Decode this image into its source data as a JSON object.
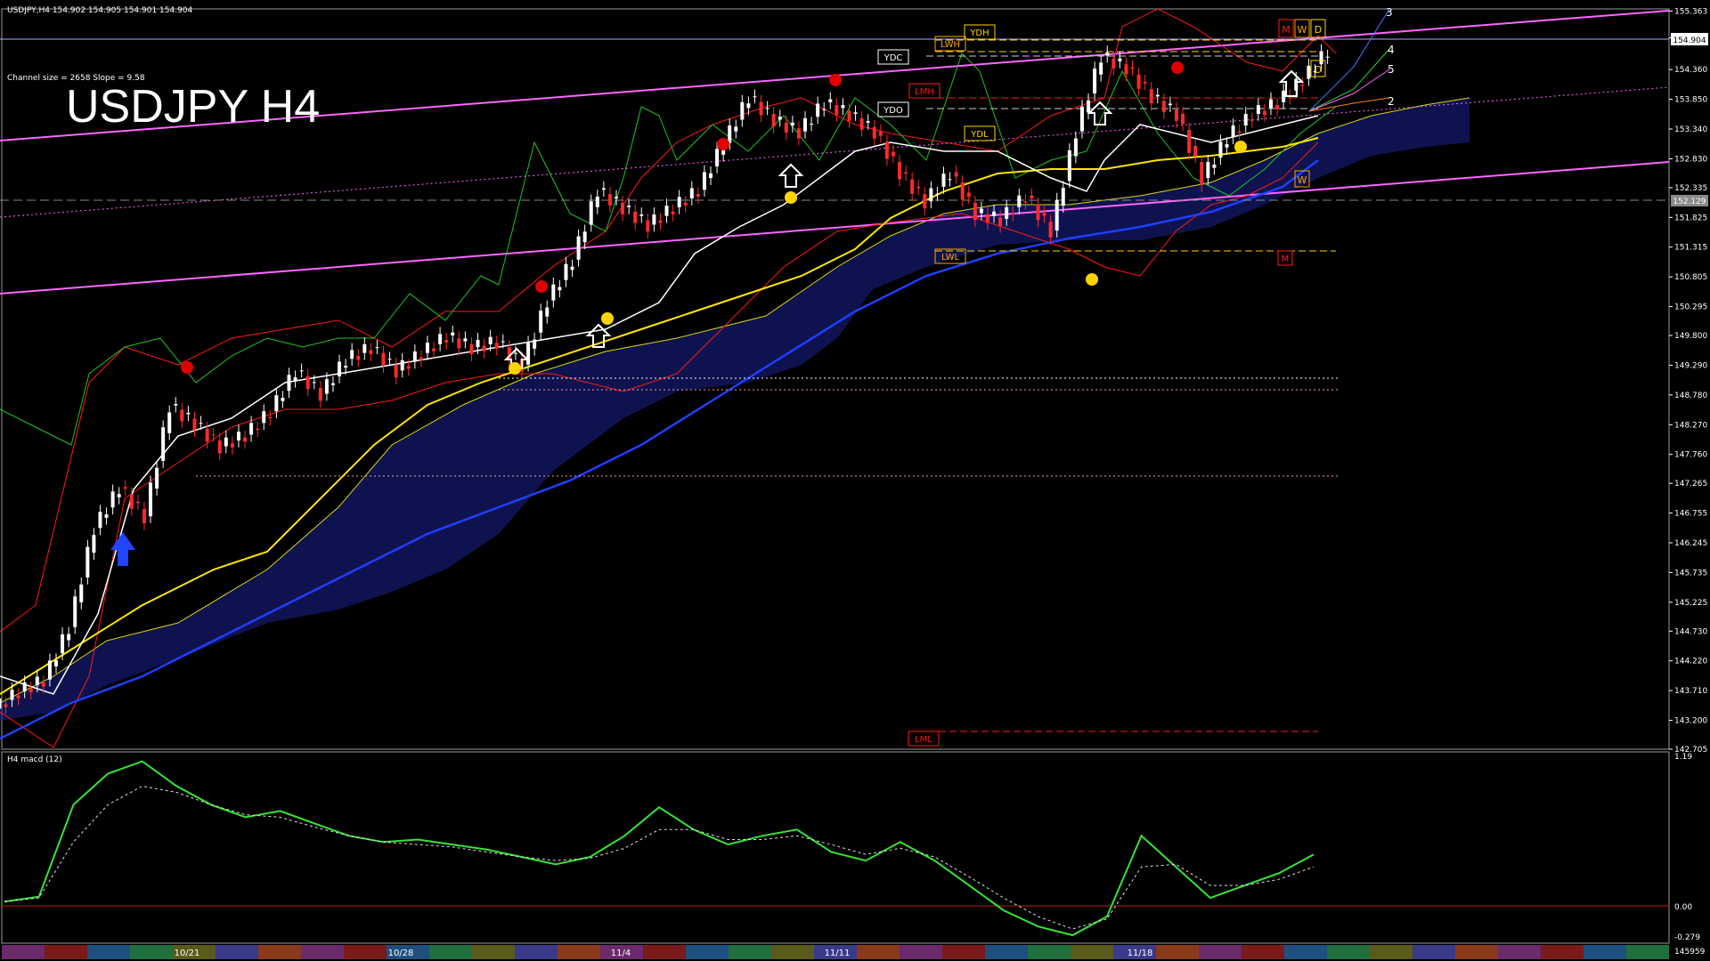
{
  "header": {
    "symbol_line": "USDJPY,H4  154.902  154.905  154.901  154.904",
    "channel_info": "Channel size = 2658 Slope = 9.58",
    "big_title": "USDJPY H4"
  },
  "colors": {
    "background": "#000000",
    "bull_candle": "#ffffff",
    "bear_candle": "#ff2a2a",
    "ema_white": "#ffffff",
    "ma_yellow": "#ffe600",
    "ma_blue": "#1f3fff",
    "channel": "#ff66ff",
    "bollinger": "#ff1a1a",
    "chikou": "#22c422",
    "cloud": "#2f3fd0",
    "macd_up": "#37e337",
    "macd_down": "#ff7fbf",
    "signal": "#dddddd",
    "grid_line": "#a0a0a0",
    "level_line": "#ffd400"
  },
  "chart_data": [
    {
      "type": "line",
      "title": "USDJPY H4",
      "current_price": 154.904,
      "reference_price": 152.129,
      "ylim": [
        142.705,
        155.4
      ],
      "y_ticks": [
        "155.363",
        "154.904",
        "154.360",
        "153.850",
        "153.340",
        "152.830",
        "152.335",
        "151.825",
        "151.315",
        "150.805",
        "150.295",
        "149.800",
        "149.290",
        "148.780",
        "148.270",
        "147.760",
        "147.265",
        "146.755",
        "146.245",
        "145.735",
        "145.225",
        "144.730",
        "144.220",
        "143.710",
        "143.200",
        "142.705"
      ],
      "x_ticks": [
        "10/21",
        "10/28",
        "11/4",
        "11/11",
        "11/18"
      ],
      "series": [
        {
          "name": "",
          "values": [
            143.7,
            143.9,
            144.8,
            146.5,
            147.2,
            146.7,
            148.6,
            148.3,
            147.9,
            148.1,
            148.5,
            149.2,
            148.8,
            149.4,
            149.6,
            149.2,
            149.5,
            149.8,
            149.6,
            149.7,
            149.3,
            150.4,
            151.1,
            152.3,
            152.0,
            151.7,
            152.0,
            152.3,
            153.1,
            153.9,
            153.5,
            153.3,
            153.8,
            153.6,
            153.3,
            152.6,
            152.1,
            152.6,
            151.9,
            151.8,
            152.2,
            151.6,
            153.3,
            154.6,
            154.4,
            153.9,
            153.6,
            152.5,
            153.2,
            153.6,
            153.8,
            154.2,
            154.7
          ]
        }
      ],
      "levels": [
        {
          "label": "YDH",
          "value": 154.93
        },
        {
          "label": "LWH",
          "value": 154.86
        },
        {
          "label": "YDC",
          "value": 154.65
        },
        {
          "label": "LMH",
          "value": 153.9
        },
        {
          "label": "YDO",
          "value": 153.75
        },
        {
          "label": "YDL",
          "value": 153.25
        },
        {
          "label": "LWL",
          "value": 151.27
        },
        {
          "label": "LML",
          "value": 142.83
        },
        {
          "label": "M",
          "value": 151.22
        }
      ],
      "right_markers": [
        "M",
        "W",
        "D",
        "D",
        "W"
      ],
      "channel_numbers": [
        "3",
        "4",
        "5",
        "2"
      ]
    },
    {
      "type": "line",
      "title": "H4  macd (12)",
      "ylim": [
        -0.279,
        1.19
      ],
      "y_ticks": [
        "1.19",
        "0.00",
        "-0.279"
      ],
      "bottom_label": "145959",
      "series": [
        {
          "name": "",
          "values": [
            0.02,
            0.06,
            0.8,
            1.05,
            1.15,
            0.95,
            0.8,
            0.7,
            0.75,
            0.65,
            0.55,
            0.5,
            0.52,
            0.48,
            0.44,
            0.38,
            0.32,
            0.38,
            0.55,
            0.78,
            0.6,
            0.48,
            0.55,
            0.6,
            0.42,
            0.35,
            0.5,
            0.35,
            0.15,
            -0.05,
            -0.18,
            -0.25,
            -0.1,
            0.55,
            0.3,
            0.05,
            0.15,
            0.25,
            0.4
          ]
        },
        {
          "name": "",
          "values": [
            0.02,
            0.05,
            0.5,
            0.8,
            0.95,
            0.9,
            0.8,
            0.72,
            0.7,
            0.62,
            0.55,
            0.5,
            0.48,
            0.46,
            0.42,
            0.38,
            0.35,
            0.37,
            0.45,
            0.6,
            0.6,
            0.52,
            0.52,
            0.55,
            0.48,
            0.4,
            0.45,
            0.38,
            0.22,
            0.05,
            -0.1,
            -0.2,
            -0.12,
            0.3,
            0.32,
            0.15,
            0.15,
            0.2,
            0.3
          ]
        }
      ]
    }
  ]
}
